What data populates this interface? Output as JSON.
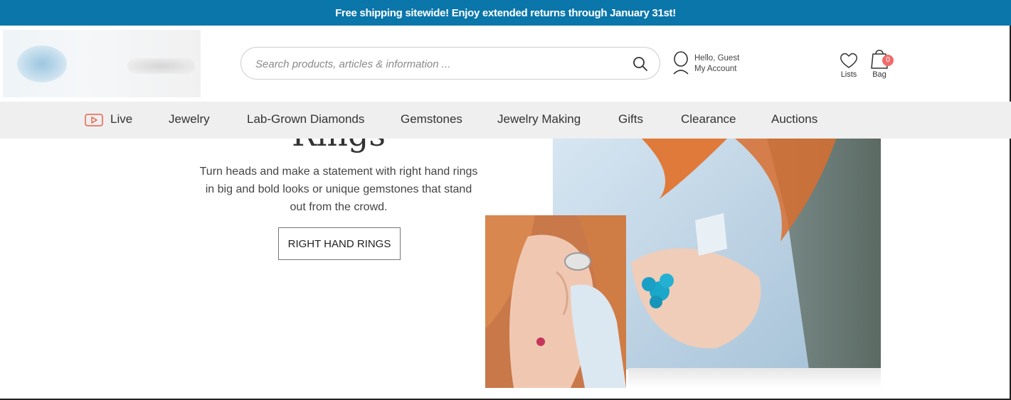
{
  "promo": {
    "text": "Free shipping sitewide! Enjoy extended returns through January 31st!"
  },
  "header": {
    "search_placeholder": "Search products, articles & information ...",
    "account": {
      "greeting": "Hello, Guest",
      "label": "My Account"
    },
    "lists": {
      "label": "Lists"
    },
    "bag": {
      "label": "Bag",
      "count": "0"
    }
  },
  "nav": {
    "items": [
      {
        "label": "Live"
      },
      {
        "label": "Jewelry"
      },
      {
        "label": "Lab-Grown Diamonds"
      },
      {
        "label": "Gemstones"
      },
      {
        "label": "Jewelry Making"
      },
      {
        "label": "Gifts"
      },
      {
        "label": "Clearance"
      },
      {
        "label": "Auctions"
      }
    ]
  },
  "hero": {
    "title": "Rings",
    "description": "Turn heads and make a statement with right hand rings in big and bold looks or unique gemstones that stand out from the crowd.",
    "button_label": "RIGHT HAND RINGS"
  },
  "colors": {
    "promo_bg": "#0a76aa",
    "nav_bg": "#efefef",
    "badge": "#f06b6b",
    "live_icon": "#e8604c"
  },
  "icons": [
    "search-icon",
    "account-icon",
    "heart-icon",
    "shopping-bag-icon",
    "play-icon"
  ]
}
